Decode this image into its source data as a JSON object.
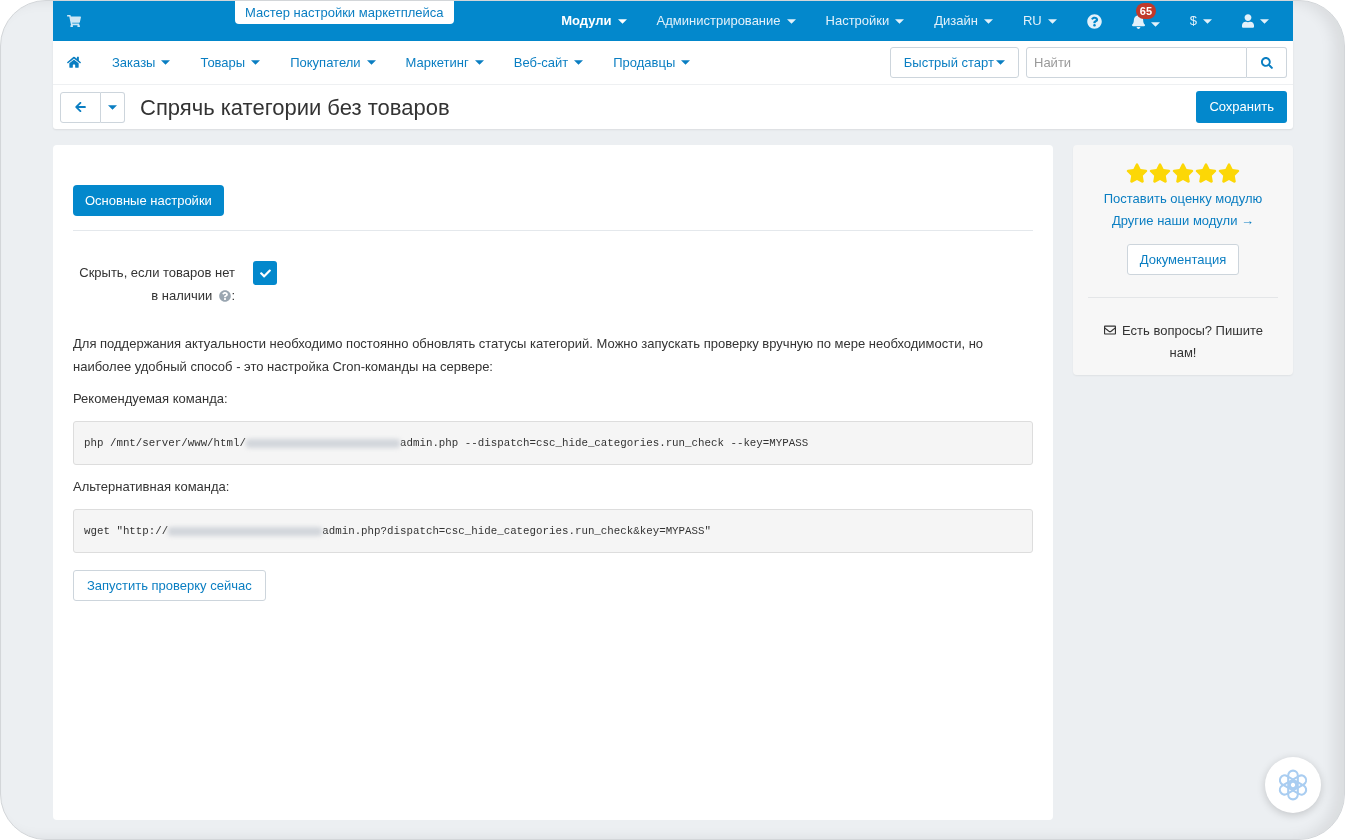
{
  "top_bar": {
    "wizard_tab": "Мастер настройки маркетплейса",
    "menu": [
      {
        "kind": "dropdown",
        "label": "Модули",
        "selected": true
      },
      {
        "kind": "dropdown",
        "label": "Администрирование",
        "selected": false
      },
      {
        "kind": "dropdown",
        "label": "Настройки",
        "selected": false
      },
      {
        "kind": "dropdown",
        "label": "Дизайн",
        "selected": false
      },
      {
        "kind": "dropdown",
        "label": "RU",
        "selected": false
      },
      {
        "kind": "help",
        "selected": false
      },
      {
        "kind": "notifications",
        "badge": "65",
        "selected": false
      },
      {
        "kind": "dropdown",
        "label": "$",
        "selected": false
      },
      {
        "kind": "user",
        "selected": false
      }
    ]
  },
  "nav": {
    "items": [
      {
        "label": "Заказы"
      },
      {
        "label": "Товары"
      },
      {
        "label": "Покупатели"
      },
      {
        "label": "Маркетинг"
      },
      {
        "label": "Веб-сайт"
      },
      {
        "label": "Продавцы"
      }
    ],
    "quick_start": "Быстрый старт",
    "search": {
      "placeholder": "Найти"
    }
  },
  "header": {
    "title": "Спрячь категории без товаров",
    "save_button": "Сохранить"
  },
  "tabs": [
    {
      "label": "Основные настройки",
      "selected": true
    }
  ],
  "settings": [
    {
      "label_lines": [
        "Скрыть, если товаров нет",
        "в наличии"
      ],
      "suffix": ":",
      "checked": true
    }
  ],
  "description": "Для поддержания актуальности необходимо постоянно обновлять статусы категорий. Можно запускать проверку вручную по мере необходимости, но наиболее удобный способ - это настройка Cron-команды на сервере:",
  "commands": [
    {
      "label": "Рекомендуемая команда:",
      "segments": [
        {
          "kind": "text",
          "text": "php /mnt/server/www/html/"
        },
        {
          "kind": "redacted"
        },
        {
          "kind": "text",
          "text": "admin.php --dispatch=csc_hide_categories.run_check --key=MYPASS"
        }
      ]
    },
    {
      "label": "Альтернативная команда:",
      "segments": [
        {
          "kind": "text",
          "text": "wget \"http://"
        },
        {
          "kind": "redacted"
        },
        {
          "kind": "text",
          "text": "admin.php?dispatch=csc_hide_categories.run_check&key=MYPASS\""
        }
      ]
    }
  ],
  "run_button": "Запустить проверку сейчас",
  "sidebar": {
    "stars": 5,
    "rate_link": "Поставить оценку модулю",
    "modules_link": "Другие наши модули →",
    "docs_button": "Документация",
    "contact": "Есть вопросы? Пишите нам!"
  }
}
